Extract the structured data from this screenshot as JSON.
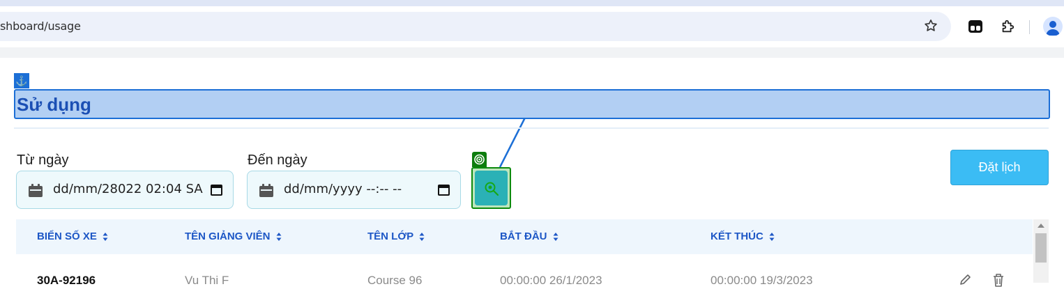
{
  "browser": {
    "url": "shboard/usage"
  },
  "page": {
    "title": "Sử dụng"
  },
  "filters": {
    "from_label": "Từ ngày",
    "from_value": "dd/mm/28022 02:04 SA",
    "to_label": "Đến ngày",
    "to_value": "dd/mm/yyyy --:-- --",
    "book_label": "Đặt lịch"
  },
  "table": {
    "columns": [
      "BIỂN SỐ XE",
      "TÊN GIẢNG VIÊN",
      "TÊN LỚP",
      "BẮT ĐẦU",
      "KẾT THÚC"
    ],
    "rows": [
      [
        "30A-92196",
        "Vu Thi F",
        "Course 96",
        "00:00:00 26/1/2023",
        "00:00:00 19/3/2023"
      ]
    ]
  },
  "colors": {
    "accent": "#1c6fd6",
    "header_text": "#1d57c6",
    "book_button": "#3bbcf4",
    "search_button": "#2bb1b6",
    "highlight": "#b2cff3"
  },
  "icons": [
    "anchor-icon",
    "star-icon",
    "extension-icon",
    "puzzle-icon",
    "profile-icon",
    "calendar-icon",
    "target-icon",
    "search-icon",
    "sort-icon",
    "edit-icon",
    "trash-icon"
  ]
}
